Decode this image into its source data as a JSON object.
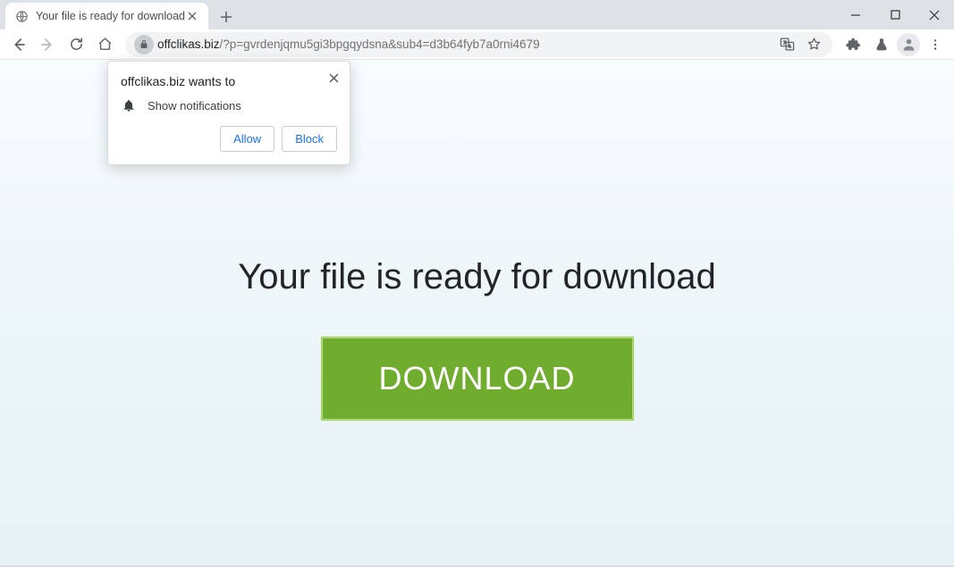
{
  "window": {},
  "tabs": {
    "active_title": "Your file is ready for download"
  },
  "toolbar": {
    "url_host": "offclikas.biz",
    "url_rest": "/?p=gvrdenjqmu5gi3bpgqydsna&sub4=d3b64fyb7a0rni4679"
  },
  "permission": {
    "title": "offclikas.biz wants to",
    "message": "Show notifications",
    "allow_label": "Allow",
    "block_label": "Block"
  },
  "page": {
    "headline": "Your file is ready for download",
    "download_label": "DOWNLOAD"
  }
}
